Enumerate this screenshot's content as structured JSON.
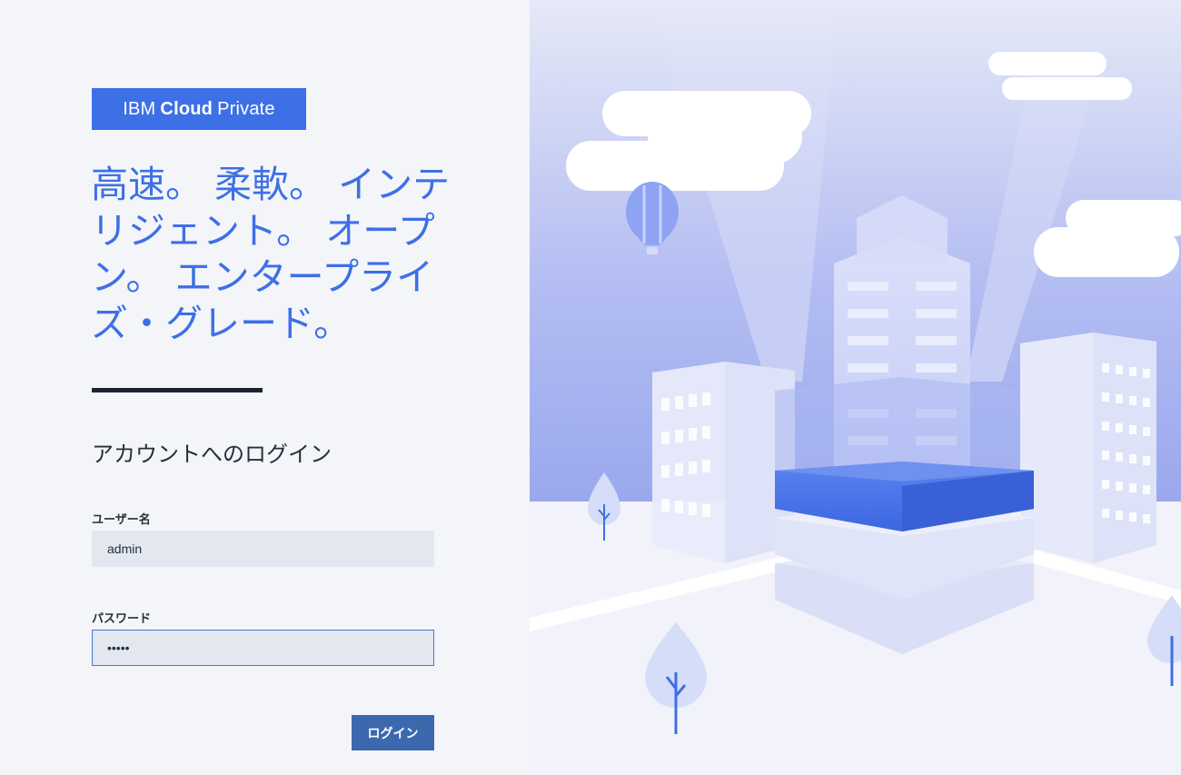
{
  "brand": {
    "prefix": "IBM",
    "bold": "Cloud",
    "suffix": "Private"
  },
  "tagline": "高速。 柔軟。 インテリジェント。 オープン。 エンタープライズ・グレード。",
  "login": {
    "title": "アカウントへのログイン",
    "username_label": "ユーザー名",
    "username_value": "admin",
    "password_label": "パスワード",
    "password_value": "•••••",
    "submit_label": "ログイン"
  },
  "colors": {
    "accent": "#3d70e6",
    "button": "#3c68ae",
    "input_bg": "#e2e7f0"
  }
}
